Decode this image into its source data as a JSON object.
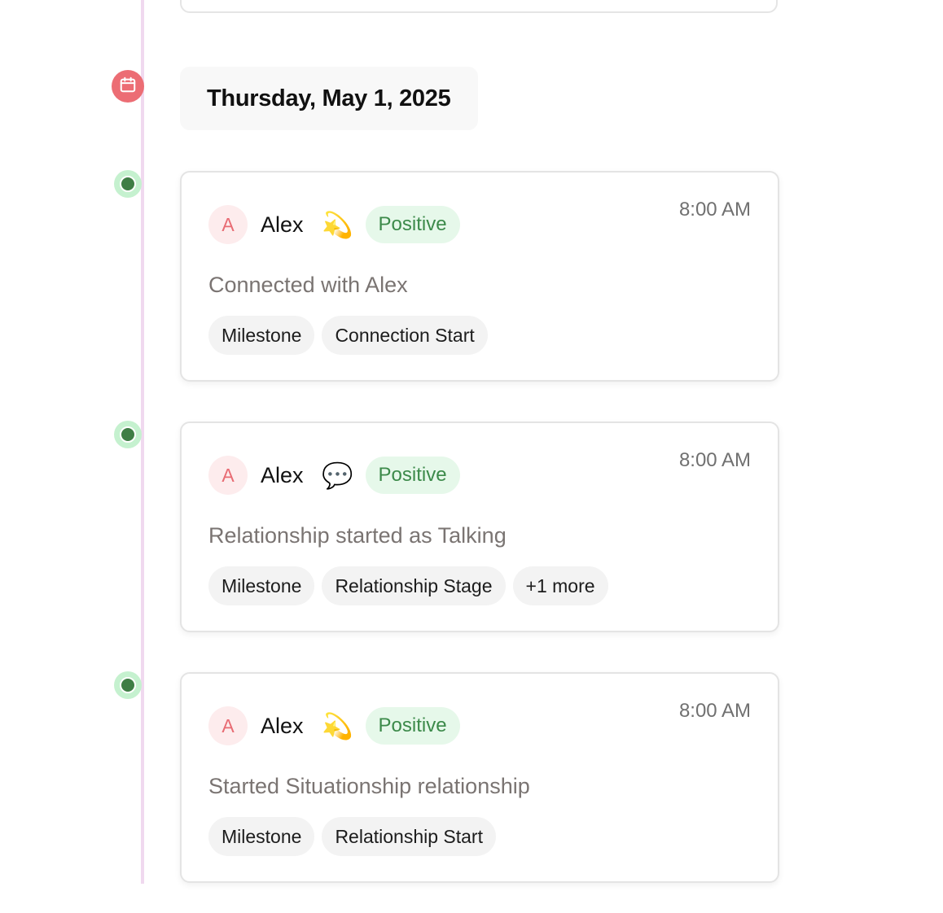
{
  "date_header": {
    "label": "Thursday, May 1, 2025",
    "icon": "calendar-icon",
    "marker_color": "#ec6d74"
  },
  "colors": {
    "timeline_line": "#f0d9ef",
    "dot_ring": "#c5f1cf",
    "dot_center": "#3f7d45",
    "sentiment_bg": "#e6f8ea",
    "sentiment_text": "#3c8a4a",
    "avatar_bg": "#fdeced",
    "avatar_text": "#e86b73"
  },
  "entries": [
    {
      "avatar_letter": "A",
      "author": "Alex",
      "emoji": "💫",
      "emoji_name": "dizzy-star-icon",
      "sentiment": "Positive",
      "time": "8:00 AM",
      "description": "Connected with Alex",
      "tags": [
        "Milestone",
        "Connection Start"
      ]
    },
    {
      "avatar_letter": "A",
      "author": "Alex",
      "emoji": "💬",
      "emoji_name": "speech-bubble-icon",
      "sentiment": "Positive",
      "time": "8:00 AM",
      "description": "Relationship started as Talking",
      "tags": [
        "Milestone",
        "Relationship Stage",
        "+1 more"
      ]
    },
    {
      "avatar_letter": "A",
      "author": "Alex",
      "emoji": "💫",
      "emoji_name": "dizzy-star-icon",
      "sentiment": "Positive",
      "time": "8:00 AM",
      "description": "Started Situationship relationship",
      "tags": [
        "Milestone",
        "Relationship Start"
      ]
    }
  ]
}
